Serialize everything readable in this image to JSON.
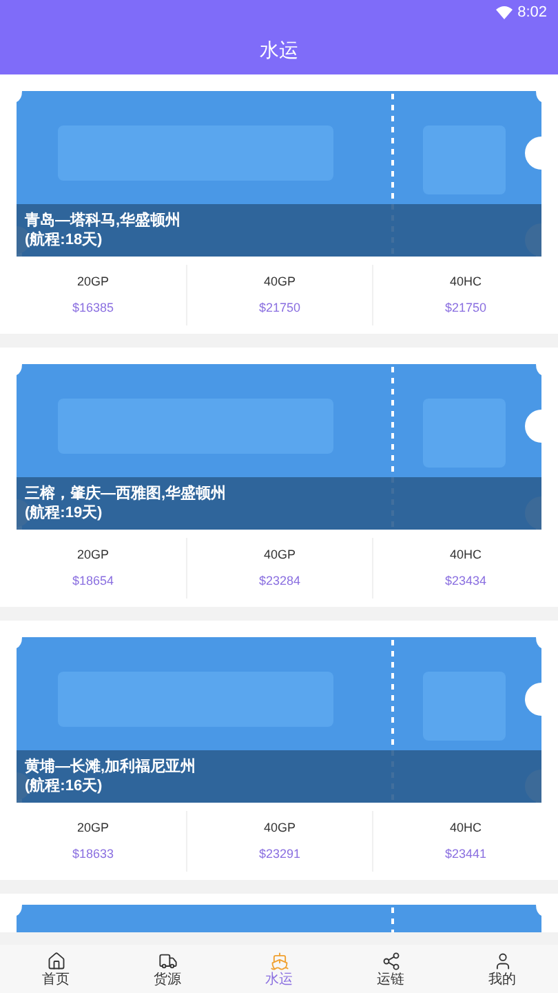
{
  "status_bar": {
    "time": "8:02"
  },
  "header": {
    "title": "水运"
  },
  "cards": [
    {
      "kind": "route",
      "route": "青岛—塔科马,华盛顿州",
      "duration": "(航程:18天)",
      "prices": [
        {
          "type": "20GP",
          "price": "$16385"
        },
        {
          "type": "40GP",
          "price": "$21750"
        },
        {
          "type": "40HC",
          "price": "$21750"
        }
      ]
    },
    {
      "kind": "route",
      "route": "三榕，肇庆—西雅图,华盛顿州",
      "duration": "(航程:19天)",
      "prices": [
        {
          "type": "20GP",
          "price": "$18654"
        },
        {
          "type": "40GP",
          "price": "$23284"
        },
        {
          "type": "40HC",
          "price": "$23434"
        }
      ]
    },
    {
      "kind": "route",
      "route": "黄埔—长滩,加利福尼亚州",
      "duration": "(航程:16天)",
      "prices": [
        {
          "type": "20GP",
          "price": "$18633"
        },
        {
          "type": "40GP",
          "price": "$23291"
        },
        {
          "type": "40HC",
          "price": "$23441"
        }
      ]
    },
    {
      "kind": "partial"
    }
  ],
  "tab_bar": [
    {
      "label": "首页",
      "selected": false
    },
    {
      "label": "货源",
      "selected": false
    },
    {
      "label": "水运",
      "selected": true
    },
    {
      "label": "运链",
      "selected": false
    },
    {
      "label": "我的",
      "selected": false
    }
  ]
}
